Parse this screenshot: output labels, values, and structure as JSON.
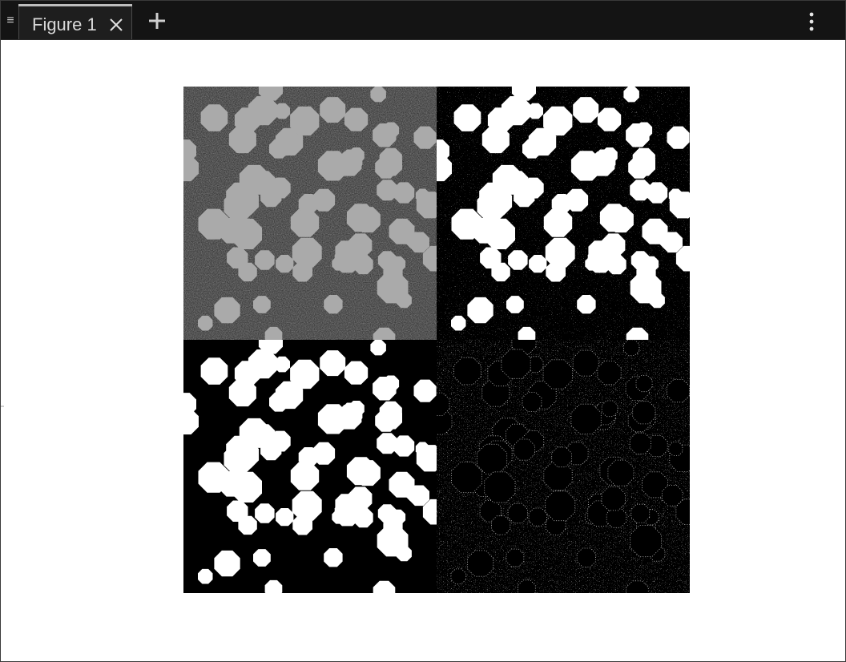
{
  "window": {
    "tabs": [
      {
        "label": "Figure 1",
        "active": true
      }
    ]
  },
  "icons": {
    "menu_handle": "hamburger-icon",
    "tab_close": "close-icon",
    "add_tab": "plus-icon",
    "overflow": "vertical-ellipsis-icon"
  },
  "colors": {
    "tabbar_bg": "#141414",
    "tab_text": "#d8d8d8",
    "canvas_bg": "#ffffff"
  },
  "figure": {
    "panels": [
      {
        "name": "noisy-grayscale-image",
        "style": "grayscale-noise"
      },
      {
        "name": "binary-threshold-noisy",
        "style": "binary-speckle"
      },
      {
        "name": "binary-cleaned",
        "style": "binary-clean"
      },
      {
        "name": "edge-map",
        "style": "edges"
      }
    ]
  }
}
